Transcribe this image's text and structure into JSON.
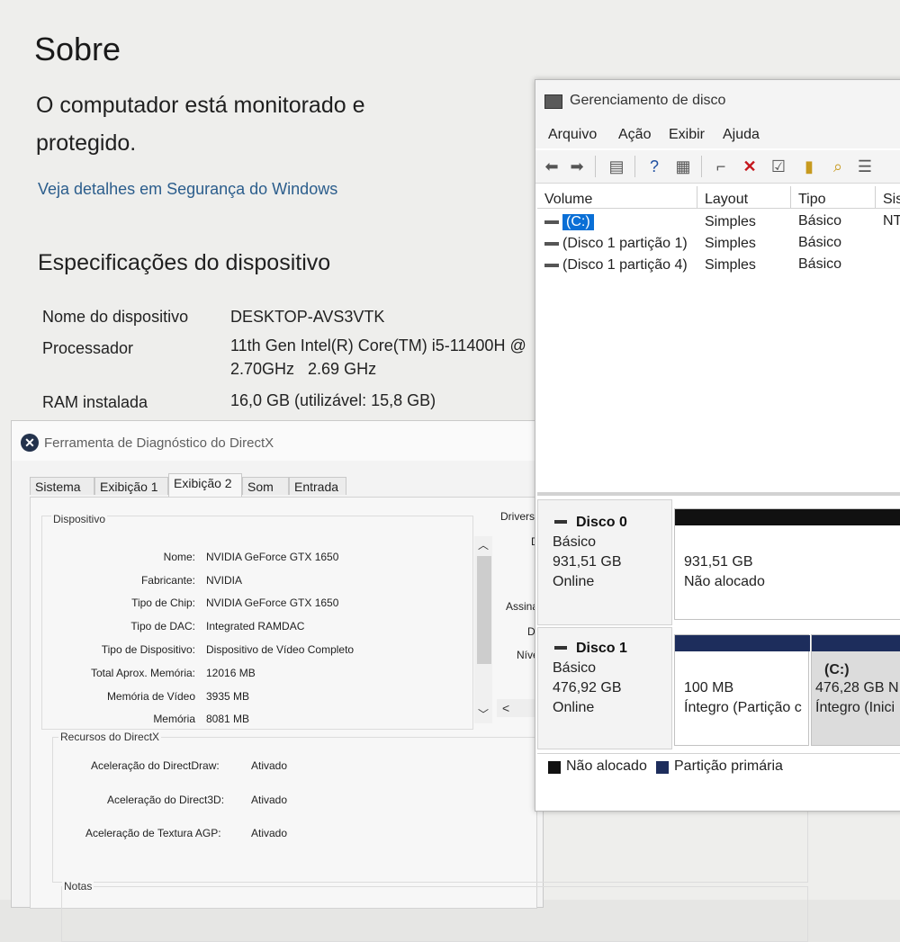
{
  "about": {
    "title": "Sobre",
    "protection_line1": "O computador está monitorado e",
    "protection_line2": "protegido.",
    "security_link": "Veja detalhes em Segurança do Windows",
    "specs_heading": "Especificações do dispositivo",
    "specs": [
      {
        "label": "Nome do dispositivo",
        "value": "DESKTOP-AVS3VTK",
        "value2": ""
      },
      {
        "label": "Processador",
        "value": "11th Gen Intel(R) Core(TM) i5-11400H @",
        "value2": "2.70GHz   2.69 GHz"
      },
      {
        "label": "RAM instalada",
        "value": "16,0 GB (utilizável: 15,8 GB)",
        "value2": ""
      }
    ]
  },
  "directx": {
    "title": "Ferramenta de Diagnóstico do DirectX",
    "tabs": [
      "Sistema",
      "Exibição 1",
      "Exibição 2",
      "Som",
      "Entrada"
    ],
    "active_tab": "Exibição 2",
    "device_group": "Dispositivo",
    "device": [
      {
        "label": "Nome:",
        "value": "NVIDIA GeForce GTX 1650"
      },
      {
        "label": "Fabricante:",
        "value": "NVIDIA"
      },
      {
        "label": "Tipo de Chip:",
        "value": "NVIDIA GeForce GTX 1650"
      },
      {
        "label": "Tipo de DAC:",
        "value": "Integrated RAMDAC"
      },
      {
        "label": "Tipo de Dispositivo:",
        "value": "Dispositivo de Vídeo Completo"
      },
      {
        "label": "Total Aprox. Memória:",
        "value": "12016 MB"
      },
      {
        "label": "Memória de Vídeo",
        "value": "3935 MB"
      },
      {
        "label": "Memória",
        "value": "8081 MB"
      }
    ],
    "drivers_label": "Drivers",
    "side_fragments": [
      "D",
      "Assina",
      "D",
      "Níve"
    ],
    "resources_group": "Recursos do DirectX",
    "resources": [
      {
        "label": "Aceleração do DirectDraw:",
        "value": "Ativado"
      },
      {
        "label": "Aceleração do Direct3D:",
        "value": "Ativado"
      },
      {
        "label": "Aceleração de Textura AGP:",
        "value": "Ativado"
      }
    ],
    "notes_group": "Notas"
  },
  "disk_mgmt": {
    "title": "Gerenciamento de disco",
    "menu": [
      "Arquivo",
      "Ação",
      "Exibir",
      "Ajuda"
    ],
    "columns": [
      "Volume",
      "Layout",
      "Tipo",
      "Sis"
    ],
    "volumes": [
      {
        "volume": "(C:)",
        "layout": "Simples",
        "tipo": "Básico",
        "sis": "NT",
        "selected": true
      },
      {
        "volume": "(Disco 1 partição 1)",
        "layout": "Simples",
        "tipo": "Básico",
        "sis": "",
        "selected": false
      },
      {
        "volume": "(Disco 1 partição 4)",
        "layout": "Simples",
        "tipo": "Básico",
        "sis": "",
        "selected": false
      }
    ],
    "disks": [
      {
        "name": "Disco 0",
        "type": "Básico",
        "size": "931,51 GB",
        "status": "Online",
        "partitions": [
          {
            "label": "",
            "size": "931,51 GB",
            "status": "Não alocado",
            "kind": "unallocated"
          }
        ]
      },
      {
        "name": "Disco 1",
        "type": "Básico",
        "size": "476,92 GB",
        "status": "Online",
        "partitions": [
          {
            "label": "",
            "size": "100 MB",
            "status": "Íntegro (Partição c",
            "kind": "primary"
          },
          {
            "label": "(C:)",
            "size": "476,28 GB N",
            "status": "Íntegro (Inici",
            "kind": "primary"
          }
        ]
      }
    ],
    "legend": [
      {
        "label": "Não alocado",
        "color": "#111111"
      },
      {
        "label": "Partição primária",
        "color": "#1d2d5c"
      }
    ]
  },
  "colors": {
    "link": "#2b5d8c",
    "selection": "#0a6fd6",
    "primary_partition": "#1d2d5c",
    "unallocated": "#111111"
  }
}
